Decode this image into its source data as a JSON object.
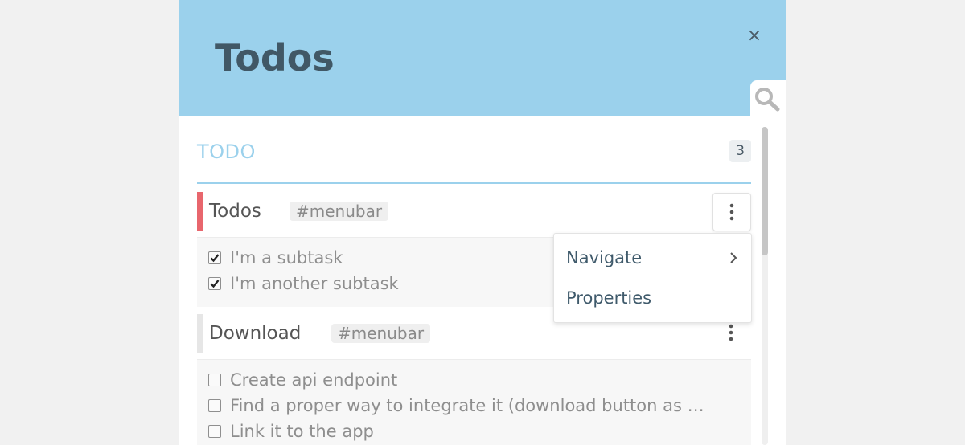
{
  "header": {
    "title": "Todos",
    "close_icon": "×",
    "background": "#9bd1ec"
  },
  "section": {
    "title": "TODO",
    "count": "3",
    "accent": "#9bd1ec"
  },
  "tasks": [
    {
      "name": "Todos",
      "tag": "#menubar",
      "priority_color": "#e8666d",
      "menu_icon": "kebab-menu-icon",
      "subtasks": [
        {
          "label": "I'm a subtask",
          "checked": true
        },
        {
          "label": "I'm another subtask",
          "checked": true
        }
      ]
    },
    {
      "name": "Download",
      "tag": "#menubar",
      "priority_color": "#e6e6e6",
      "menu_icon": "kebab-menu-icon",
      "subtasks": [
        {
          "label": "Create api endpoint",
          "checked": false
        },
        {
          "label": "Find a proper way to integrate it (download button as …",
          "checked": false
        },
        {
          "label": "Link it to the app",
          "checked": false
        }
      ]
    }
  ],
  "dropdown": {
    "items": [
      {
        "label": "Navigate",
        "has_submenu": true
      },
      {
        "label": "Properties",
        "has_submenu": false
      }
    ]
  },
  "icons": {
    "search": "search-icon",
    "close": "close-icon",
    "chevron": "chevron-right-icon",
    "checkbox": "checkbox-icon"
  }
}
